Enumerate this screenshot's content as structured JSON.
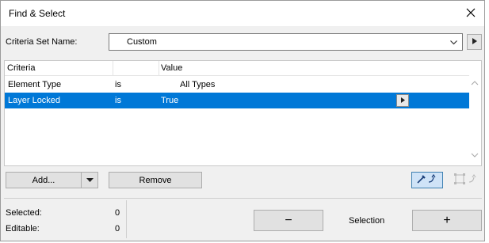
{
  "window": {
    "title": "Find & Select"
  },
  "criteria_set": {
    "label": "Criteria Set Name:",
    "value": "Custom"
  },
  "table": {
    "columns": [
      "Criteria",
      "Value"
    ],
    "rows": [
      {
        "criteria": "Element Type",
        "operator": "is",
        "value": "All Types",
        "selected": false
      },
      {
        "criteria": "Layer Locked",
        "operator": "is",
        "value": "True",
        "selected": true
      }
    ]
  },
  "buttons": {
    "add": "Add...",
    "remove": "Remove",
    "minus": "−",
    "plus": "+"
  },
  "status": {
    "selected_label": "Selected:",
    "selected_value": "0",
    "editable_label": "Editable:",
    "editable_value": "0"
  },
  "selection_label": "Selection",
  "colors": {
    "selection_highlight": "#0078d7",
    "tool_active_bg": "#cfe3f7"
  },
  "icons": [
    "close-icon",
    "chevron-down-icon",
    "arrow-right-icon",
    "scroll-up-icon",
    "scroll-down-icon",
    "eyedropper-icon",
    "marquee-icon"
  ]
}
